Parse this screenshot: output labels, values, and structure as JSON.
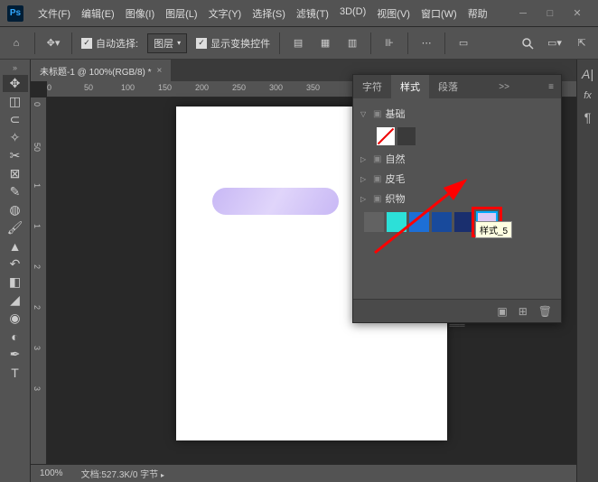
{
  "menu": [
    "文件(F)",
    "编辑(E)",
    "图像(I)",
    "图层(L)",
    "文字(Y)",
    "选择(S)",
    "滤镜(T)",
    "3D(D)",
    "视图(V)",
    "窗口(W)",
    "帮助"
  ],
  "optbar": {
    "auto_select": "自动选择:",
    "dropdown": "图层",
    "show_transform": "显示变换控件"
  },
  "tab": {
    "title": "未标题-1 @ 100%(RGB/8) *"
  },
  "ruler_h": [
    "0",
    "50",
    "100",
    "150",
    "200",
    "250",
    "300",
    "350"
  ],
  "ruler_v": [
    "0",
    "50",
    "1",
    "1",
    "2",
    "2",
    "3",
    "3"
  ],
  "status": {
    "zoom": "100%",
    "doc": "文档:527.3K/0 字节"
  },
  "panel": {
    "tabs": [
      "字符",
      "样式",
      "段落"
    ],
    "more": ">>",
    "folders": {
      "basic": "基础",
      "nature": "自然",
      "fur": "皮毛",
      "fabric": "织物"
    },
    "colors": [
      "#626262",
      "#2ce0d8",
      "#1d6fd6",
      "#184a9c",
      "#1a2f6e",
      "#dcc9f5"
    ],
    "tooltip": "样式_5"
  }
}
